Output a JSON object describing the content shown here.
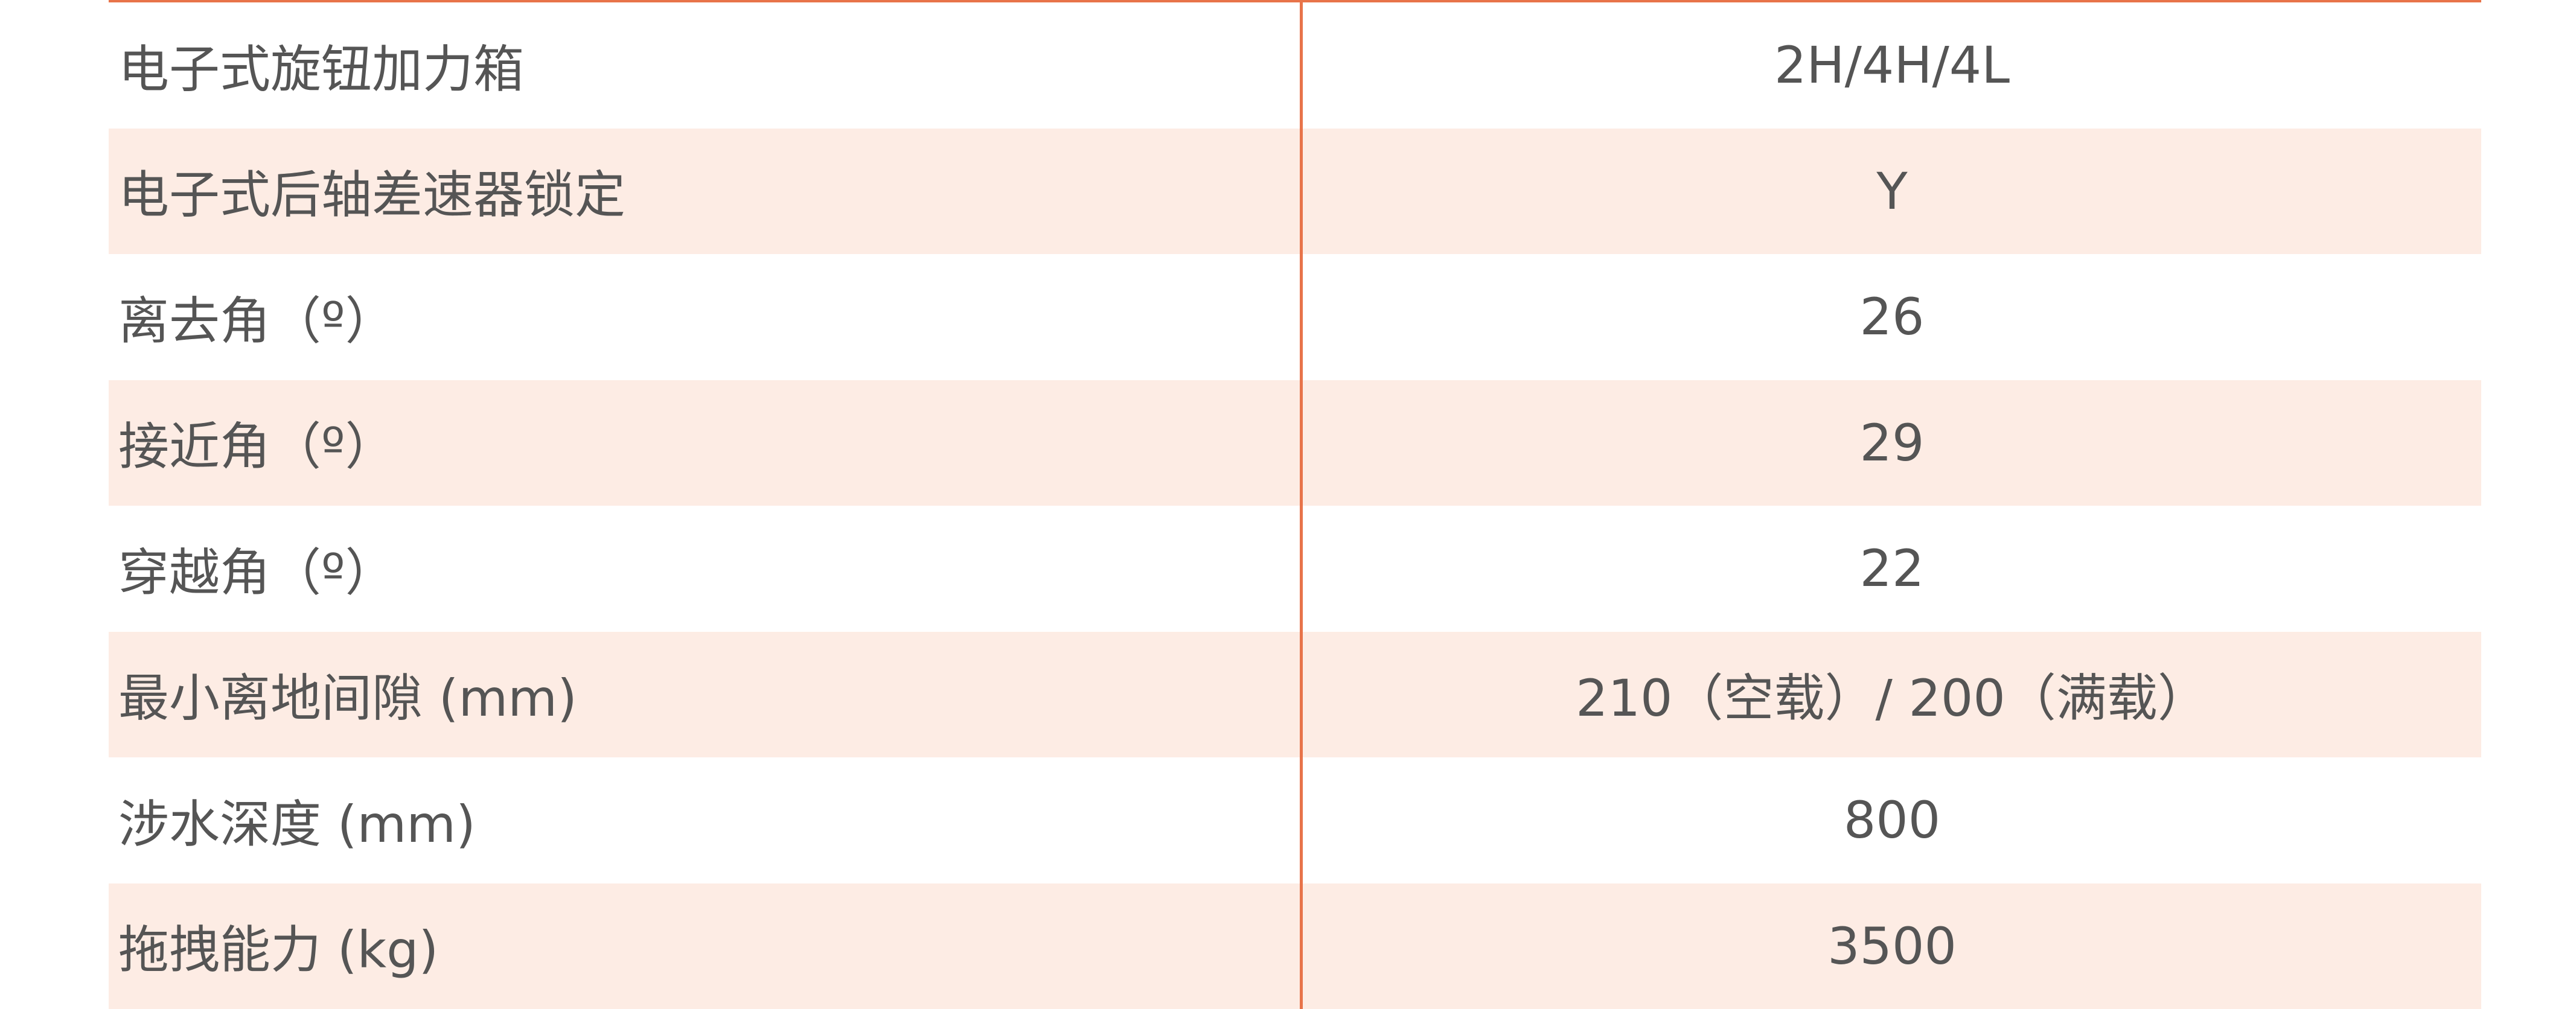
{
  "spec_table": {
    "rows": [
      {
        "label": "电子式旋钮加力箱",
        "value": "2H/4H/4L"
      },
      {
        "label": "电子式后轴差速器锁定",
        "value": "Y"
      },
      {
        "label": "离去角（º）",
        "value": "26"
      },
      {
        "label": "接近角（º）",
        "value": "29"
      },
      {
        "label": "穿越角（º）",
        "value": "22"
      },
      {
        "label": "最小离地间隙 (mm)",
        "value": "210（空载）/ 200（满载）"
      },
      {
        "label": "涉水深度 (mm)",
        "value": "800"
      },
      {
        "label": "拖拽能力 (kg)",
        "value": "3500"
      }
    ]
  },
  "colors": {
    "accent": "#e8744a",
    "row_shade": "#fdece4",
    "text": "#555555"
  }
}
